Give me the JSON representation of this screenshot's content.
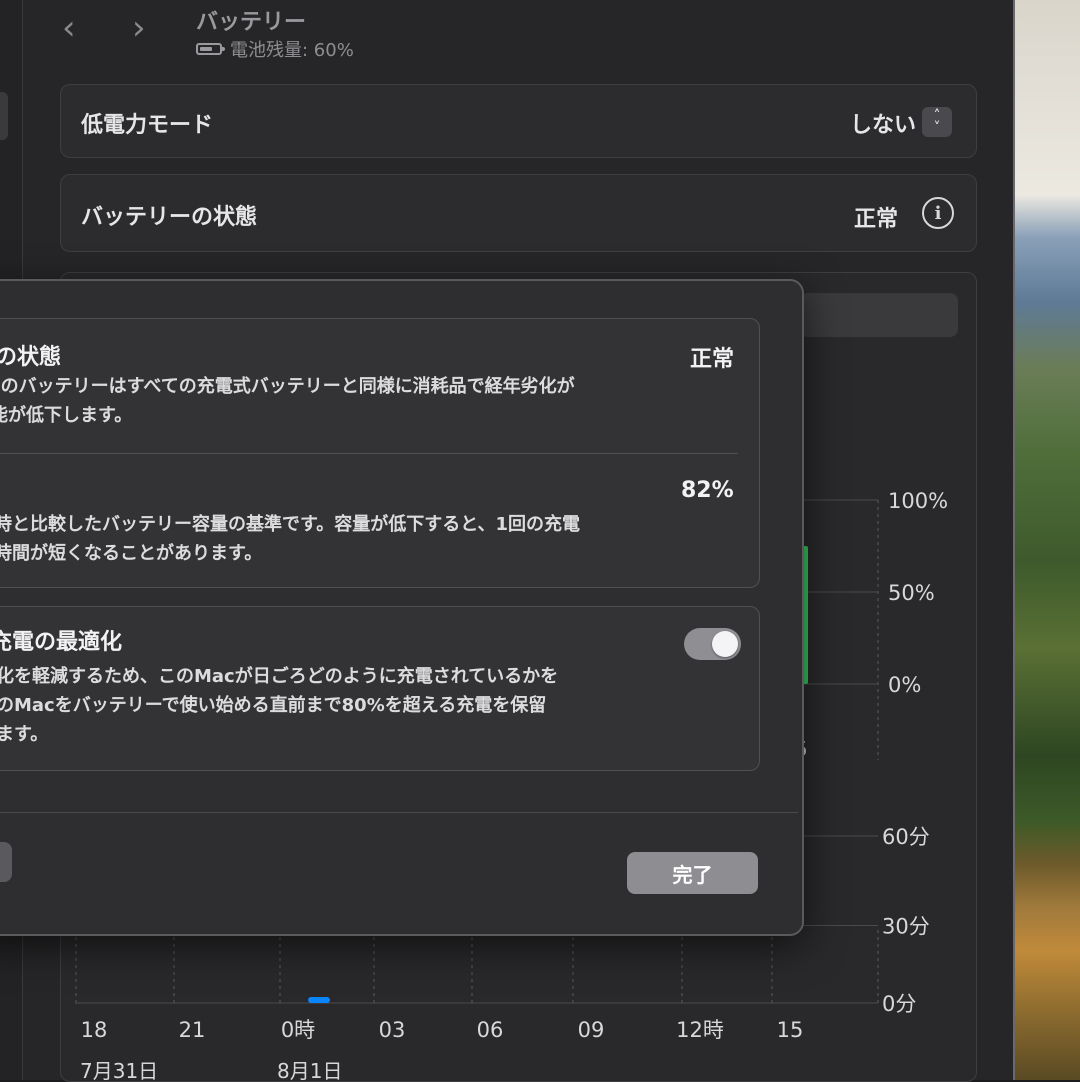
{
  "header": {
    "title": "バッテリー",
    "subtitle": "電池残量: 60%"
  },
  "low_power": {
    "label": "低電力モード",
    "value": "しない"
  },
  "battery_health": {
    "label": "バッテリーの状態",
    "value": "正常"
  },
  "sheet": {
    "health_title": "の状態",
    "health_value": "正常",
    "health_desc_line1": "cのバッテリーはすべての充電式バッテリーと同様に消耗品で経年劣化が",
    "health_desc_line2": "能が低下します。",
    "capacity_value": "82%",
    "capacity_desc_line1": "時と比較したバッテリー容量の基準です。容量が低下すると、1回の充電",
    "capacity_desc_line2": "時間が短くなることがあります。",
    "optimize_title": "充電の最適化",
    "optimize_desc_line1": "化を軽減するため、このMacが日ごろどのように充電されているかを",
    "optimize_desc_line2": "のMacをバッテリーで使い始める直前まで80%を超える充電を保留",
    "optimize_desc_line3": "ます。",
    "optimize_enabled": true,
    "done_label": "完了"
  },
  "chart_data": [
    {
      "type": "bar",
      "title": "",
      "ylabel": "",
      "y_ticks": [
        "100%",
        "50%",
        "0%"
      ],
      "ylim": [
        0,
        100
      ],
      "visible_x_label": "5",
      "series": [
        {
          "values": [
            75
          ],
          "color": "#34c759"
        }
      ]
    },
    {
      "type": "bar",
      "title": "",
      "ylabel": "",
      "y_ticks": [
        "60分",
        "30分",
        "0分"
      ],
      "ylim": [
        0,
        60
      ],
      "categories": [
        "18",
        "21",
        "0時",
        "03",
        "06",
        "09",
        "12時",
        "15"
      ],
      "date_labels": [
        "7月31日",
        "8月1日"
      ],
      "series": [
        {
          "values": [
            0,
            0,
            2,
            0,
            0,
            0,
            0,
            0
          ],
          "color": "#0a84ff"
        }
      ]
    }
  ],
  "colors": {
    "window_bg": "#262628",
    "sheet_bg": "#2e2e30",
    "battery_level": "#34c759",
    "screen_time": "#0a84ff"
  }
}
